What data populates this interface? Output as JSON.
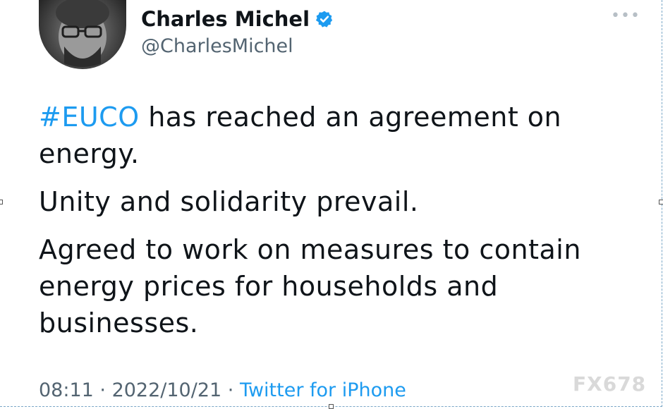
{
  "author": {
    "name": "Charles Michel",
    "handle": "@CharlesMichel",
    "verified": true
  },
  "more_icon": "more-horizontal-icon",
  "tweet": {
    "hashtag": "#EUCO",
    "line1_rest": " has reached an agreement on energy.",
    "paragraph2": "Unity and solidarity prevail.",
    "paragraph3": "Agreed to work on measures to contain energy prices for households and businesses."
  },
  "meta": {
    "time": "08:11",
    "separator": " · ",
    "date": "2022/10/21",
    "source": "Twitter for iPhone"
  },
  "watermark": "FX678",
  "colors": {
    "link": "#1d9bf0",
    "secondary_text": "#536471",
    "primary_text": "#0f1419"
  }
}
